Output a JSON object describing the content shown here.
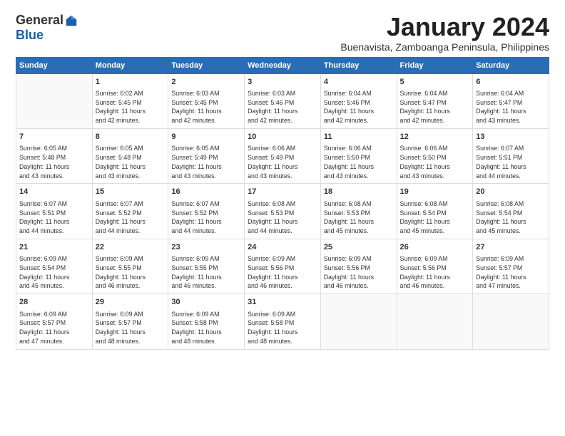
{
  "logo": {
    "general": "General",
    "blue": "Blue"
  },
  "title": "January 2024",
  "subtitle": "Buenavista, Zamboanga Peninsula, Philippines",
  "headers": [
    "Sunday",
    "Monday",
    "Tuesday",
    "Wednesday",
    "Thursday",
    "Friday",
    "Saturday"
  ],
  "weeks": [
    [
      {
        "day": "",
        "info": ""
      },
      {
        "day": "1",
        "info": "Sunrise: 6:02 AM\nSunset: 5:45 PM\nDaylight: 11 hours\nand 42 minutes."
      },
      {
        "day": "2",
        "info": "Sunrise: 6:03 AM\nSunset: 5:45 PM\nDaylight: 11 hours\nand 42 minutes."
      },
      {
        "day": "3",
        "info": "Sunrise: 6:03 AM\nSunset: 5:46 PM\nDaylight: 11 hours\nand 42 minutes."
      },
      {
        "day": "4",
        "info": "Sunrise: 6:04 AM\nSunset: 5:46 PM\nDaylight: 11 hours\nand 42 minutes."
      },
      {
        "day": "5",
        "info": "Sunrise: 6:04 AM\nSunset: 5:47 PM\nDaylight: 11 hours\nand 42 minutes."
      },
      {
        "day": "6",
        "info": "Sunrise: 6:04 AM\nSunset: 5:47 PM\nDaylight: 11 hours\nand 43 minutes."
      }
    ],
    [
      {
        "day": "7",
        "info": "Sunrise: 6:05 AM\nSunset: 5:48 PM\nDaylight: 11 hours\nand 43 minutes."
      },
      {
        "day": "8",
        "info": "Sunrise: 6:05 AM\nSunset: 5:48 PM\nDaylight: 11 hours\nand 43 minutes."
      },
      {
        "day": "9",
        "info": "Sunrise: 6:05 AM\nSunset: 5:49 PM\nDaylight: 11 hours\nand 43 minutes."
      },
      {
        "day": "10",
        "info": "Sunrise: 6:06 AM\nSunset: 5:49 PM\nDaylight: 11 hours\nand 43 minutes."
      },
      {
        "day": "11",
        "info": "Sunrise: 6:06 AM\nSunset: 5:50 PM\nDaylight: 11 hours\nand 43 minutes."
      },
      {
        "day": "12",
        "info": "Sunrise: 6:06 AM\nSunset: 5:50 PM\nDaylight: 11 hours\nand 43 minutes."
      },
      {
        "day": "13",
        "info": "Sunrise: 6:07 AM\nSunset: 5:51 PM\nDaylight: 11 hours\nand 44 minutes."
      }
    ],
    [
      {
        "day": "14",
        "info": "Sunrise: 6:07 AM\nSunset: 5:51 PM\nDaylight: 11 hours\nand 44 minutes."
      },
      {
        "day": "15",
        "info": "Sunrise: 6:07 AM\nSunset: 5:52 PM\nDaylight: 11 hours\nand 44 minutes."
      },
      {
        "day": "16",
        "info": "Sunrise: 6:07 AM\nSunset: 5:52 PM\nDaylight: 11 hours\nand 44 minutes."
      },
      {
        "day": "17",
        "info": "Sunrise: 6:08 AM\nSunset: 5:53 PM\nDaylight: 11 hours\nand 44 minutes."
      },
      {
        "day": "18",
        "info": "Sunrise: 6:08 AM\nSunset: 5:53 PM\nDaylight: 11 hours\nand 45 minutes."
      },
      {
        "day": "19",
        "info": "Sunrise: 6:08 AM\nSunset: 5:54 PM\nDaylight: 11 hours\nand 45 minutes."
      },
      {
        "day": "20",
        "info": "Sunrise: 6:08 AM\nSunset: 5:54 PM\nDaylight: 11 hours\nand 45 minutes."
      }
    ],
    [
      {
        "day": "21",
        "info": "Sunrise: 6:09 AM\nSunset: 5:54 PM\nDaylight: 11 hours\nand 45 minutes."
      },
      {
        "day": "22",
        "info": "Sunrise: 6:09 AM\nSunset: 5:55 PM\nDaylight: 11 hours\nand 46 minutes."
      },
      {
        "day": "23",
        "info": "Sunrise: 6:09 AM\nSunset: 5:55 PM\nDaylight: 11 hours\nand 46 minutes."
      },
      {
        "day": "24",
        "info": "Sunrise: 6:09 AM\nSunset: 5:56 PM\nDaylight: 11 hours\nand 46 minutes."
      },
      {
        "day": "25",
        "info": "Sunrise: 6:09 AM\nSunset: 5:56 PM\nDaylight: 11 hours\nand 46 minutes."
      },
      {
        "day": "26",
        "info": "Sunrise: 6:09 AM\nSunset: 5:56 PM\nDaylight: 11 hours\nand 46 minutes."
      },
      {
        "day": "27",
        "info": "Sunrise: 6:09 AM\nSunset: 5:57 PM\nDaylight: 11 hours\nand 47 minutes."
      }
    ],
    [
      {
        "day": "28",
        "info": "Sunrise: 6:09 AM\nSunset: 5:57 PM\nDaylight: 11 hours\nand 47 minutes."
      },
      {
        "day": "29",
        "info": "Sunrise: 6:09 AM\nSunset: 5:57 PM\nDaylight: 11 hours\nand 48 minutes."
      },
      {
        "day": "30",
        "info": "Sunrise: 6:09 AM\nSunset: 5:58 PM\nDaylight: 11 hours\nand 48 minutes."
      },
      {
        "day": "31",
        "info": "Sunrise: 6:09 AM\nSunset: 5:58 PM\nDaylight: 11 hours\nand 48 minutes."
      },
      {
        "day": "",
        "info": ""
      },
      {
        "day": "",
        "info": ""
      },
      {
        "day": "",
        "info": ""
      }
    ]
  ]
}
